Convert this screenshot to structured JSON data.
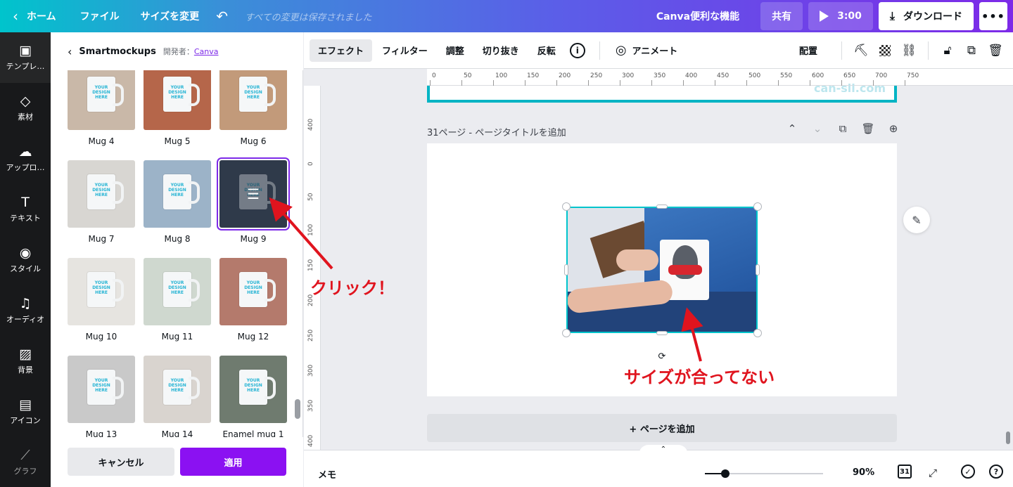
{
  "topbar": {
    "home": "ホーム",
    "file": "ファイル",
    "resize": "サイズを変更",
    "saved": "すべての変更は保存されました",
    "features": "Canva便利な機能",
    "share": "共有",
    "present_time": "3:00",
    "download": "ダウンロード",
    "more": "•••"
  },
  "rail": {
    "items": [
      {
        "label": "テンプレ…",
        "icon": "template-icon"
      },
      {
        "label": "素材",
        "icon": "elements-icon"
      },
      {
        "label": "アップロ…",
        "icon": "upload-icon"
      },
      {
        "label": "テキスト",
        "icon": "text-icon"
      },
      {
        "label": "スタイル",
        "icon": "style-icon"
      },
      {
        "label": "オーディオ",
        "icon": "audio-icon"
      },
      {
        "label": "背景",
        "icon": "background-icon"
      },
      {
        "label": "アイコン",
        "icon": "icon-icon"
      },
      {
        "label": "グラフ",
        "icon": "chart-icon"
      }
    ]
  },
  "panel": {
    "title": "Smartmockups",
    "developer_label": "開発者：",
    "developer_link": "Canva",
    "thumbs": [
      {
        "label": "Mug 4",
        "bg": "#c9b8a8"
      },
      {
        "label": "Mug 5",
        "bg": "#b5664a"
      },
      {
        "label": "Mug 6",
        "bg": "#c29a7a"
      },
      {
        "label": "Mug 7",
        "bg": "#d8d6d2"
      },
      {
        "label": "Mug 8",
        "bg": "#9cb3c8"
      },
      {
        "label": "Mug 9",
        "bg": "#2f3a4a"
      },
      {
        "label": "Mug 10",
        "bg": "#e6e4e0"
      },
      {
        "label": "Mug 11",
        "bg": "#cfd8cf"
      },
      {
        "label": "Mug 12",
        "bg": "#b47a6c"
      },
      {
        "label": "Mug 13",
        "bg": "#c9c9c9"
      },
      {
        "label": "Mug 14",
        "bg": "#d9d4cf"
      },
      {
        "label": "Enamel mug 1",
        "bg": "#6f7b6f"
      }
    ],
    "mug_text": "YOUR DESIGN HERE",
    "cancel": "キャンセル",
    "apply": "適用"
  },
  "toolbar": {
    "effects": "エフェクト",
    "filter": "フィルター",
    "adjust": "調整",
    "crop": "切り抜き",
    "flip": "反転",
    "info": "i",
    "animate": "アニメート",
    "position": "配置"
  },
  "canvas": {
    "ruler_top": [
      "0",
      "50",
      "100",
      "150",
      "200",
      "250",
      "300",
      "350",
      "400",
      "450",
      "500",
      "550",
      "600",
      "650",
      "700",
      "750"
    ],
    "ruler_left": [
      "400",
      "0",
      "50",
      "100",
      "150",
      "200",
      "250",
      "300",
      "350",
      "400"
    ],
    "prev_watermark": "can-sii.com",
    "page_title": "31ページ - ページタイトルを追加",
    "add_page": "+ ページを追加"
  },
  "bottombar": {
    "memo": "メモ",
    "zoom": "90%",
    "zoom_level": 0.17,
    "page_count": "31"
  },
  "annotations": {
    "click": "クリック！",
    "size_mismatch": "サイズが合ってない"
  },
  "colors": {
    "accent": "#7d2ae8",
    "apply": "#8b11f2",
    "selection": "#00c4cc",
    "annotation": "#e0141e"
  }
}
